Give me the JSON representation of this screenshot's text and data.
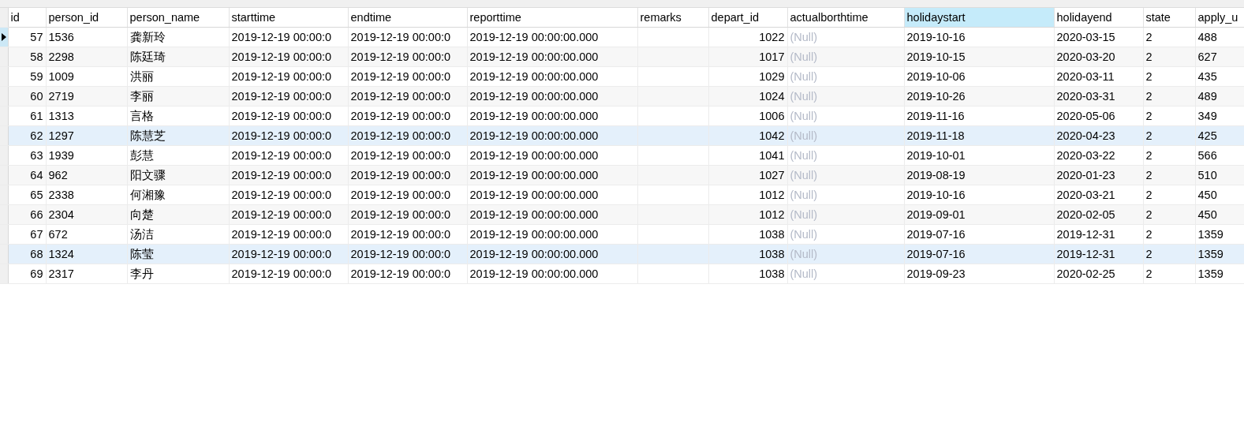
{
  "table": {
    "columns": [
      {
        "label": "id",
        "kind": "number",
        "selected": false
      },
      {
        "label": "person_id",
        "kind": "text",
        "selected": false
      },
      {
        "label": "person_name",
        "kind": "text",
        "selected": false
      },
      {
        "label": "starttime",
        "kind": "text",
        "selected": false
      },
      {
        "label": "endtime",
        "kind": "text",
        "selected": false
      },
      {
        "label": "reporttime",
        "kind": "text",
        "selected": false
      },
      {
        "label": "remarks",
        "kind": "text",
        "selected": false
      },
      {
        "label": "depart_id",
        "kind": "number",
        "selected": false
      },
      {
        "label": "actualborthtime",
        "kind": "null",
        "selected": false
      },
      {
        "label": "holidaystart",
        "kind": "text",
        "selected": true
      },
      {
        "label": "holidayend",
        "kind": "text",
        "selected": false
      },
      {
        "label": "state",
        "kind": "text",
        "selected": false
      },
      {
        "label": "apply_u",
        "kind": "text",
        "selected": false
      }
    ],
    "rows": [
      {
        "current": true,
        "highlighted": false,
        "cells": [
          "57",
          "1536",
          "龚新玲",
          "2019-12-19 00:00:0",
          "2019-12-19 00:00:0",
          "2019-12-19 00:00:00.000",
          "",
          "1022",
          "(Null)",
          "2019-10-16",
          "2020-03-15",
          "2",
          "488"
        ]
      },
      {
        "current": false,
        "highlighted": false,
        "cells": [
          "58",
          "2298",
          "陈廷琦",
          "2019-12-19 00:00:0",
          "2019-12-19 00:00:0",
          "2019-12-19 00:00:00.000",
          "",
          "1017",
          "(Null)",
          "2019-10-15",
          "2020-03-20",
          "2",
          "627"
        ]
      },
      {
        "current": false,
        "highlighted": false,
        "cells": [
          "59",
          "1009",
          "洪丽",
          "2019-12-19 00:00:0",
          "2019-12-19 00:00:0",
          "2019-12-19 00:00:00.000",
          "",
          "1029",
          "(Null)",
          "2019-10-06",
          "2020-03-11",
          "2",
          "435"
        ]
      },
      {
        "current": false,
        "highlighted": false,
        "cells": [
          "60",
          "2719",
          "李丽",
          "2019-12-19 00:00:0",
          "2019-12-19 00:00:0",
          "2019-12-19 00:00:00.000",
          "",
          "1024",
          "(Null)",
          "2019-10-26",
          "2020-03-31",
          "2",
          "489"
        ]
      },
      {
        "current": false,
        "highlighted": false,
        "cells": [
          "61",
          "1313",
          "言格",
          "2019-12-19 00:00:0",
          "2019-12-19 00:00:0",
          "2019-12-19 00:00:00.000",
          "",
          "1006",
          "(Null)",
          "2019-11-16",
          "2020-05-06",
          "2",
          "349"
        ]
      },
      {
        "current": false,
        "highlighted": true,
        "cells": [
          "62",
          "1297",
          "陈慧芝",
          "2019-12-19 00:00:0",
          "2019-12-19 00:00:0",
          "2019-12-19 00:00:00.000",
          "",
          "1042",
          "(Null)",
          "2019-11-18",
          "2020-04-23",
          "2",
          "425"
        ]
      },
      {
        "current": false,
        "highlighted": false,
        "cells": [
          "63",
          "1939",
          "彭慧",
          "2019-12-19 00:00:0",
          "2019-12-19 00:00:0",
          "2019-12-19 00:00:00.000",
          "",
          "1041",
          "(Null)",
          "2019-10-01",
          "2020-03-22",
          "2",
          "566"
        ]
      },
      {
        "current": false,
        "highlighted": false,
        "cells": [
          "64",
          "962",
          "阳文骤",
          "2019-12-19 00:00:0",
          "2019-12-19 00:00:0",
          "2019-12-19 00:00:00.000",
          "",
          "1027",
          "(Null)",
          "2019-08-19",
          "2020-01-23",
          "2",
          "510"
        ]
      },
      {
        "current": false,
        "highlighted": false,
        "cells": [
          "65",
          "2338",
          "何湘豫",
          "2019-12-19 00:00:0",
          "2019-12-19 00:00:0",
          "2019-12-19 00:00:00.000",
          "",
          "1012",
          "(Null)",
          "2019-10-16",
          "2020-03-21",
          "2",
          "450"
        ]
      },
      {
        "current": false,
        "highlighted": false,
        "cells": [
          "66",
          "2304",
          "向楚",
          "2019-12-19 00:00:0",
          "2019-12-19 00:00:0",
          "2019-12-19 00:00:00.000",
          "",
          "1012",
          "(Null)",
          "2019-09-01",
          "2020-02-05",
          "2",
          "450"
        ]
      },
      {
        "current": false,
        "highlighted": false,
        "cells": [
          "67",
          "672",
          "汤洁",
          "2019-12-19 00:00:0",
          "2019-12-19 00:00:0",
          "2019-12-19 00:00:00.000",
          "",
          "1038",
          "(Null)",
          "2019-07-16",
          "2019-12-31",
          "2",
          "1359"
        ]
      },
      {
        "current": false,
        "highlighted": true,
        "cells": [
          "68",
          "1324",
          "陈莹",
          "2019-12-19 00:00:0",
          "2019-12-19 00:00:0",
          "2019-12-19 00:00:00.000",
          "",
          "1038",
          "(Null)",
          "2019-07-16",
          "2019-12-31",
          "2",
          "1359"
        ]
      },
      {
        "current": false,
        "highlighted": false,
        "cells": [
          "69",
          "2317",
          "李丹",
          "2019-12-19 00:00:0",
          "2019-12-19 00:00:0",
          "2019-12-19 00:00:00.000",
          "",
          "1038",
          "(Null)",
          "2019-09-23",
          "2020-02-25",
          "2",
          "1359"
        ]
      }
    ]
  }
}
